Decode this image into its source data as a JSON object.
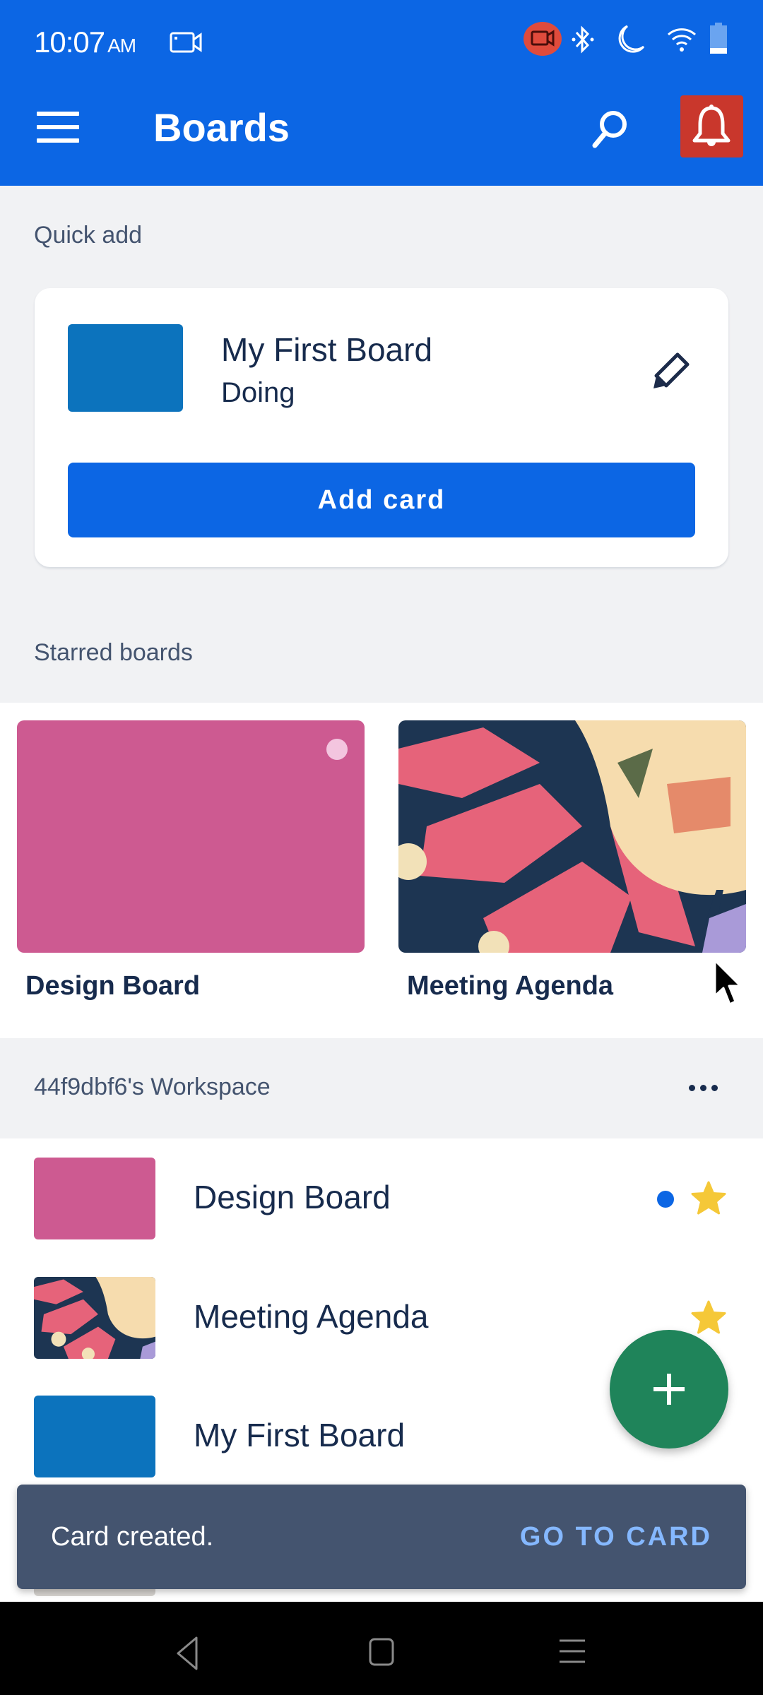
{
  "status_bar": {
    "time": "10:07",
    "ampm": "AM",
    "icons": [
      "screen-record-icon",
      "bluetooth-icon",
      "do-not-disturb-icon",
      "wifi-icon",
      "battery-icon"
    ]
  },
  "app_bar": {
    "title": "Boards",
    "menu_icon": "hamburger-menu-icon",
    "search_icon": "search-icon",
    "notification_icon": "bell-icon"
  },
  "quick_add": {
    "section_label": "Quick add",
    "board_name": "My First Board",
    "list_name": "Doing",
    "board_color": "#0c73bd",
    "edit_icon": "pencil-icon",
    "add_button_label": "Add card"
  },
  "starred": {
    "section_label": "Starred boards",
    "boards": [
      {
        "name": "Design Board",
        "background": "#cd5a91",
        "has_activity_dot": true
      },
      {
        "name": "Meeting Agenda",
        "background": "image"
      }
    ]
  },
  "workspace": {
    "title": "44f9dbf6's Workspace",
    "more_icon": "more-horizontal-icon",
    "boards": [
      {
        "name": "Design Board",
        "background": "#cd5a91",
        "unread": true,
        "starred": true
      },
      {
        "name": "Meeting Agenda",
        "background": "image",
        "unread": false,
        "starred": true
      },
      {
        "name": "My First Board",
        "background": "#0c73bd",
        "unread": false,
        "starred": false
      }
    ]
  },
  "fab": {
    "icon": "plus-icon"
  },
  "snackbar": {
    "message": "Card created.",
    "action": "GO TO CARD"
  },
  "nav_bar": {
    "icons": [
      "back-icon",
      "home-icon",
      "recents-icon"
    ]
  },
  "colors": {
    "brand": "#0c66e4",
    "notification_bg": "#c9372c",
    "fab": "#1f845a",
    "star": "#f5c838",
    "snackbar": "#44546f",
    "snackbar_action": "#85b8ff"
  }
}
